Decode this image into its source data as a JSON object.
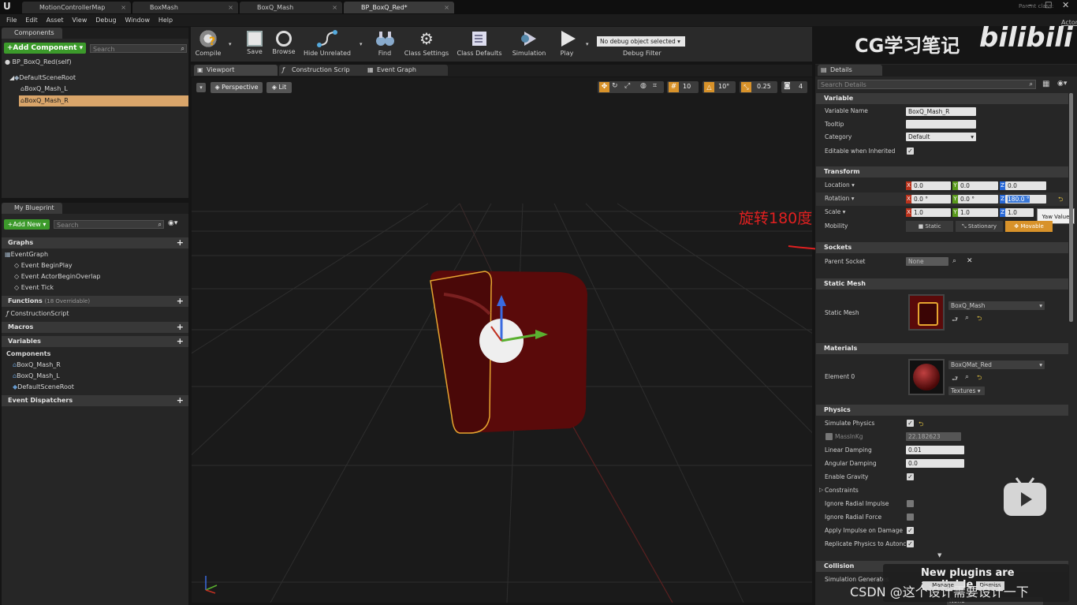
{
  "window": {
    "tabs": [
      {
        "label": "MotionControllerMap"
      },
      {
        "label": "BoxMash"
      },
      {
        "label": "BoxQ_Mash"
      },
      {
        "label": "BP_BoxQ_Red*"
      }
    ],
    "parent_class_label": "Parent class:",
    "parent_class_value": "Actor"
  },
  "menu": [
    "File",
    "Edit",
    "Asset",
    "View",
    "Debug",
    "Window",
    "Help"
  ],
  "components_panel": {
    "tab": "Components",
    "add_button": "+Add Component",
    "search_placeholder": "Search",
    "self_item": "BP_BoxQ_Red(self)",
    "tree": [
      "DefaultSceneRoot",
      "BoxQ_Mash_L",
      "BoxQ_Mash_R"
    ]
  },
  "my_blueprint": {
    "tab": "My Blueprint",
    "add_new": "+Add New",
    "search_placeholder": "Search",
    "graphs_header": "Graphs",
    "event_graph": "EventGraph",
    "events": [
      "Event BeginPlay",
      "Event ActorBeginOverlap",
      "Event Tick"
    ],
    "functions_header": "Functions",
    "functions_note": "(18 Overridable)",
    "construction_script": "ConstructionScript",
    "macros_header": "Macros",
    "variables_header": "Variables",
    "components_sub": "Components",
    "variables": [
      "BoxQ_Mash_R",
      "BoxQ_Mash_L",
      "DefaultSceneRoot"
    ],
    "event_dispatchers": "Event Dispatchers"
  },
  "toolbar": {
    "buttons": [
      "Compile",
      "Save",
      "Browse",
      "Hide Unrelated",
      "Find",
      "Class Settings",
      "Class Defaults",
      "Simulation",
      "Play"
    ],
    "debug_select": "No debug object selected",
    "debug_filter": "Debug Filter"
  },
  "editor_tabs": [
    "Viewport",
    "Construction Scrip",
    "Event Graph"
  ],
  "viewport": {
    "perspective": "Perspective",
    "lit": "Lit",
    "grid_snap": "10",
    "rot_snap": "10°",
    "scale_snap": "0.25",
    "cam_speed": "4"
  },
  "watermark": {
    "brand": "CG学习笔记",
    "logo_text": "bilibili"
  },
  "annotation": {
    "text": "旋转180度",
    "color": "#e02020"
  },
  "details": {
    "tab": "Details",
    "search_placeholder": "Search Details",
    "variable_section": "Variable",
    "variable_name_label": "Variable Name",
    "variable_name_value": "BoxQ_Mash_R",
    "tooltip_label": "Tooltip",
    "category_label": "Category",
    "category_value": "Default",
    "editable_label": "Editable when Inherited",
    "transform_section": "Transform",
    "location_label": "Location",
    "location": [
      "0.0",
      "0.0",
      "0.0"
    ],
    "rotation_label": "Rotation",
    "rotation": [
      "0.0 °",
      "0.0 °",
      "180.0 °"
    ],
    "scale_label": "Scale",
    "scale": [
      "1.0",
      "1.0",
      "1.0"
    ],
    "tooltip_popup": "Yaw Value",
    "mobility_label": "Mobility",
    "mobility_options": [
      "Static",
      "Stationary",
      "Movable"
    ],
    "sockets_section": "Sockets",
    "parent_socket_label": "Parent Socket",
    "parent_socket_value": "None",
    "static_mesh_section": "Static Mesh",
    "static_mesh_label": "Static Mesh",
    "static_mesh_value": "BoxQ_Mash",
    "materials_section": "Materials",
    "element0_label": "Element 0",
    "material_value": "BoxQMat_Red",
    "textures_button": "Textures",
    "physics_section": "Physics",
    "physics_rows": [
      {
        "label": "Simulate Physics"
      },
      {
        "label": "MassInKg",
        "value": "22.182623"
      },
      {
        "label": "Linear Damping",
        "value": "0.01"
      },
      {
        "label": "Angular Damping",
        "value": "0.0"
      },
      {
        "label": "Enable Gravity"
      },
      {
        "label": "Constraints"
      },
      {
        "label": "Ignore Radial Impulse"
      },
      {
        "label": "Ignore Radial Force"
      },
      {
        "label": "Apply Impulse on Damage"
      },
      {
        "label": "Replicate Physics to Autonc"
      }
    ],
    "collision_section": "Collision",
    "sim_gen_label": "Simulation Generates",
    "none_value": "None"
  },
  "notification": {
    "text": "New plugins are available",
    "manage": "Manage Plugins",
    "dismiss": "Dismiss"
  },
  "csdn_watermark": "CSDN @这个设计需要设计一下"
}
